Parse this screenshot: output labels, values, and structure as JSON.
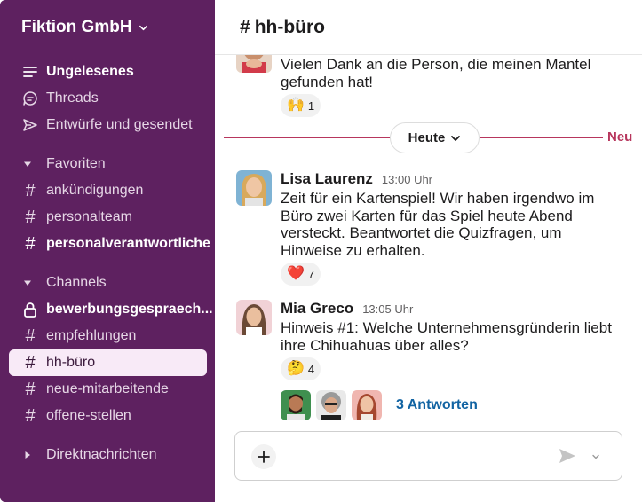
{
  "sidebar": {
    "workspace": "Fiktion GmbH",
    "items": [
      {
        "label": "Ungelesenes",
        "icon": "unread-list-icon"
      },
      {
        "label": "Threads",
        "icon": "threads-icon"
      },
      {
        "label": "Entwürfe und gesendet",
        "icon": "send-icon"
      }
    ],
    "favorites": {
      "title": "Favoriten",
      "channels": [
        "ankündigungen",
        "personalteam",
        "personalverantwortliche"
      ]
    },
    "channels": {
      "title": "Channels",
      "list": [
        "bewerbungsgespraech...",
        "empfehlungen",
        "hh-büro",
        "neue-mitarbeitende",
        "offene-stellen"
      ]
    },
    "dms_title": "Direktnachrichten",
    "hash": "#"
  },
  "main": {
    "channel_hash": "#",
    "channel_name": "hh-büro",
    "divider_label": "Heute",
    "new_label": "Neu",
    "messages": [
      {
        "lines": [
          "Vielen Dank an die Person, die meinen Mantel",
          "gefunden hat!"
        ],
        "reaction": {
          "emoji": "🙌",
          "count": "1"
        }
      },
      {
        "author": "Lisa Laurenz",
        "time": "13:00 Uhr",
        "lines": [
          "Zeit für ein Kartenspiel! Wir haben irgendwo im",
          "Büro zwei Karten für das Spiel heute Abend",
          "versteckt. Beantwortet die Quizfragen, um",
          "Hinweise zu erhalten."
        ],
        "reaction": {
          "emoji": "❤️",
          "count": "7"
        }
      },
      {
        "author": "Mia Greco",
        "time": "13:05 Uhr",
        "lines": [
          "Hinweis #1: Welche Unternehmensgründerin liebt",
          "ihre Chihuahuas über alles?"
        ],
        "reaction": {
          "emoji": "🤔",
          "count": "4"
        },
        "replies": "3 Antworten"
      }
    ]
  },
  "colors": {
    "sidebar_bg": "#5e2160",
    "active_item_bg": "#f8eaf7",
    "new_divider": "#b7365d",
    "link": "#1264a3"
  }
}
